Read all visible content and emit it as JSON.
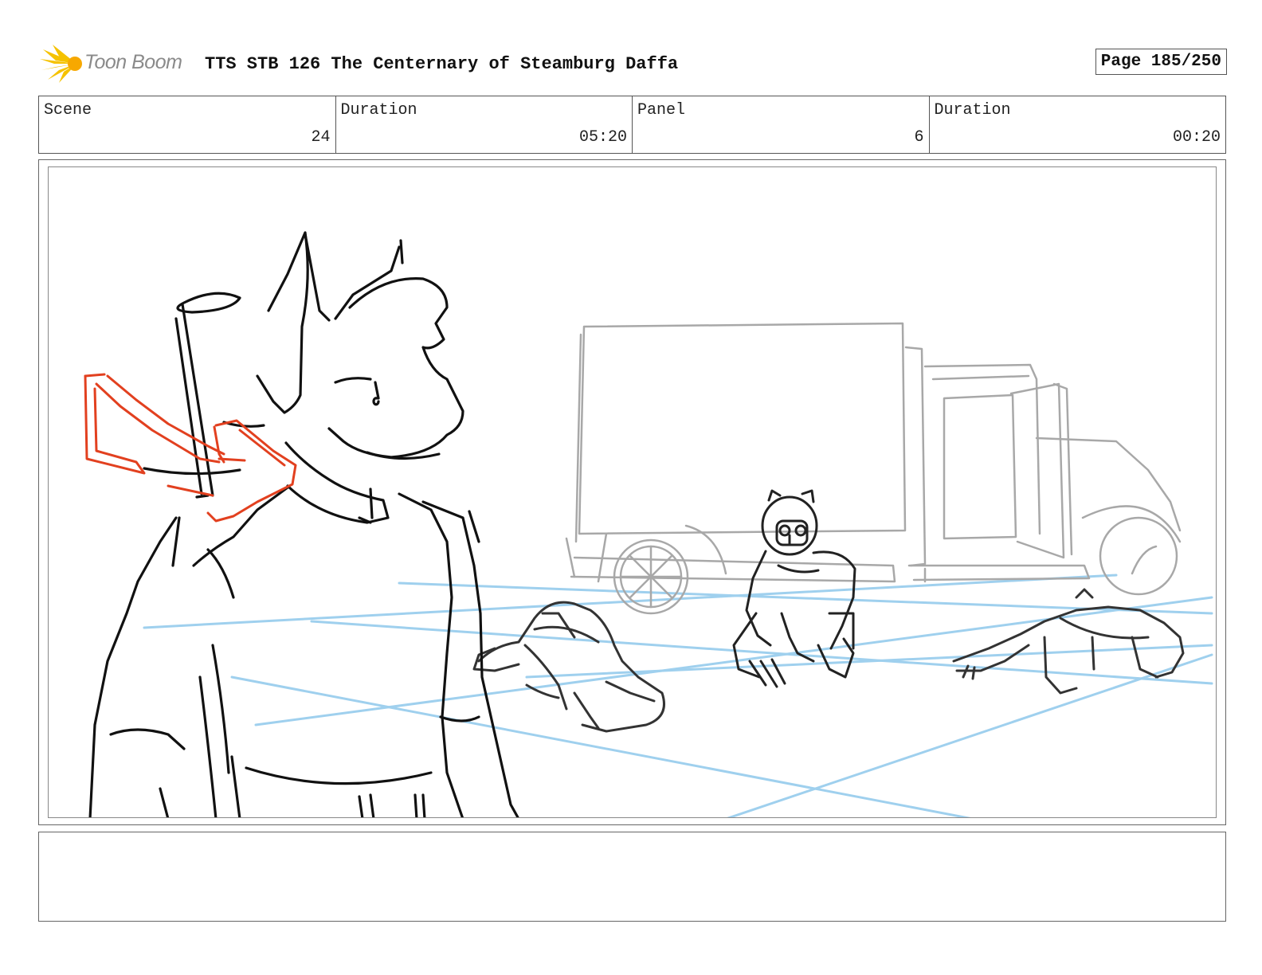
{
  "header": {
    "logo_text": "Toon Boom",
    "title": "TTS STB 126 The Centernary of Steamburg Daffa",
    "page_label": "Page 185/250"
  },
  "info": [
    {
      "label": "Scene",
      "value": "24"
    },
    {
      "label": "Duration",
      "value": "05:20"
    },
    {
      "label": "Panel",
      "value": "6"
    },
    {
      "label": "Duration",
      "value": "00:20"
    }
  ],
  "colors": {
    "logo_yellow": "#f5c200",
    "sketch_black": "#111111",
    "sketch_gray": "#a8a8a8",
    "perspective_blue": "#9fd0ee",
    "arrow_red": "#e2401f"
  },
  "notes": ""
}
